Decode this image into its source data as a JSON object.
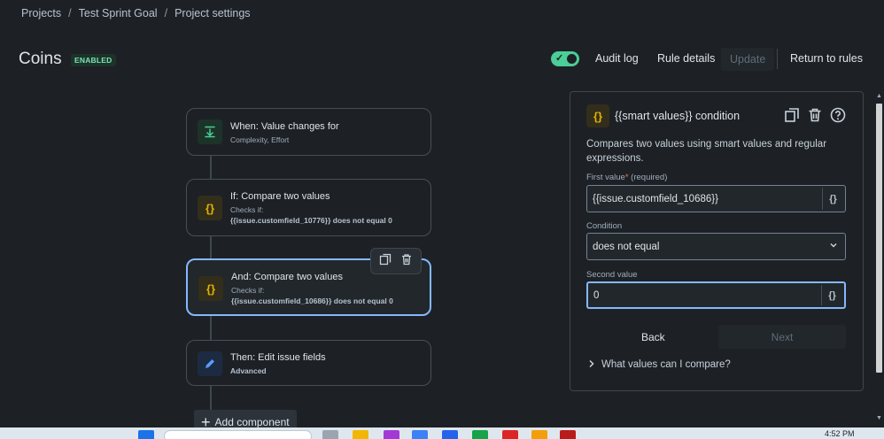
{
  "breadcrumb": {
    "items": [
      "Projects",
      "Test Sprint Goal",
      "Project settings"
    ],
    "separator": "/"
  },
  "header": {
    "title": "Coins",
    "badge": "ENABLED",
    "toggle_on": true,
    "audit_log": "Audit log",
    "rule_details": "Rule details",
    "update": "Update",
    "return_to_rules": "Return to rules"
  },
  "flow": {
    "trigger": {
      "title": "When: Value changes for",
      "subtitle": "Complexity, Effort",
      "icon": "download-arrow-icon"
    },
    "condition1": {
      "title": "If: Compare two values",
      "checks_label": "Checks if:",
      "detail": "{{issue.customfield_10776}} does not equal 0",
      "icon": "braces-icon"
    },
    "condition2": {
      "title": "And: Compare two values",
      "checks_label": "Checks if:",
      "detail": "{{issue.customfield_10686}} does not equal 0",
      "icon": "braces-icon"
    },
    "action": {
      "title": "Then: Edit issue fields",
      "subtitle": "Advanced",
      "icon": "pencil-icon"
    },
    "add_component": "Add component",
    "icon_glyph": "{}"
  },
  "panel": {
    "title": "{{smart values}} condition",
    "description": "Compares two values using smart values and regular expressions.",
    "first_value_label": "First value",
    "first_value_required_star": "*",
    "first_value_required": "(required)",
    "first_value": "{{issue.customfield_10686}}",
    "condition_label": "Condition",
    "condition_value": "does not equal",
    "second_value_label": "Second value",
    "second_value": "0",
    "smart_btn": "{}",
    "back": "Back",
    "next": "Next",
    "expander": "What values can I compare?"
  },
  "taskbar": {
    "time": "4:52 PM"
  },
  "colors": {
    "background": "#1d2125",
    "accent_green": "#4bce97",
    "selected_border": "#85b8ff",
    "braces_yellow": "#e2b203"
  }
}
